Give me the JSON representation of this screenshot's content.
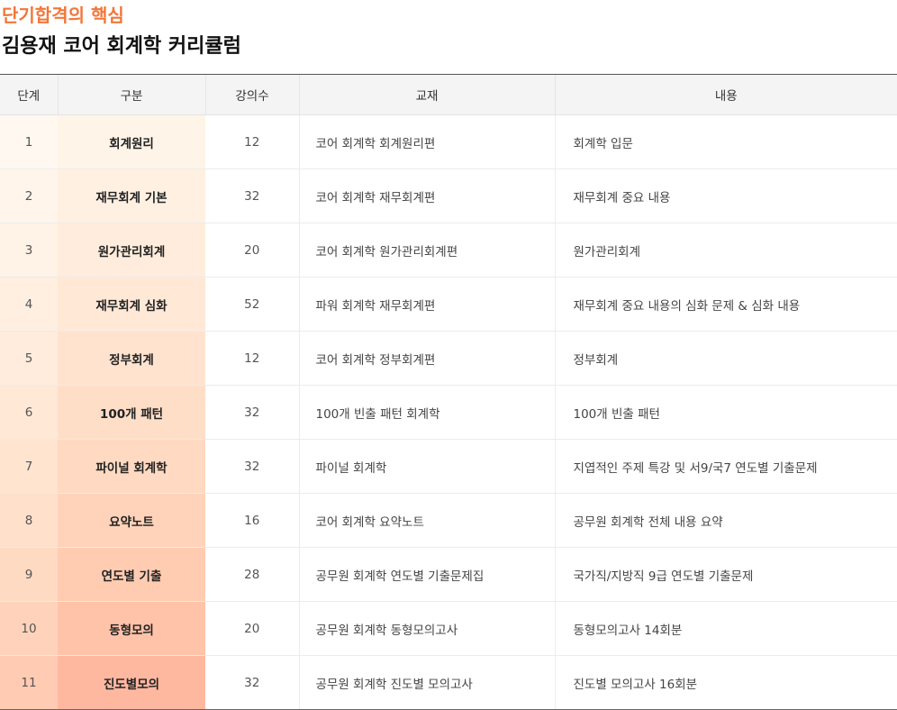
{
  "header": {
    "subtitle": "단기합격의 핵심",
    "title": "김용재 코어 회계학 커리큘럼"
  },
  "table": {
    "columns": [
      "단계",
      "구분",
      "강의수",
      "교재",
      "내용"
    ],
    "rows": [
      {
        "step": "1",
        "name": "회계원리",
        "count": "12",
        "book": "코어 회계학 회계원리편",
        "desc": "회계학 입문",
        "shade_step": "#fff8f0",
        "shade_name": "#fff4e8"
      },
      {
        "step": "2",
        "name": "재무회계 기본",
        "count": "32",
        "book": "코어 회계학 재무회계편",
        "desc": "재무회계 중요 내용",
        "shade_step": "#fff5eb",
        "shade_name": "#fff0e2"
      },
      {
        "step": "3",
        "name": "원가관리회계",
        "count": "20",
        "book": "코어 회계학 원가관리회계편",
        "desc": "원가관리회계",
        "shade_step": "#fff2e6",
        "shade_name": "#ffecdc"
      },
      {
        "step": "4",
        "name": "재무회계 심화",
        "count": "52",
        "book": "파워 회계학 재무회계편",
        "desc": "재무회계 중요 내용의 심화 문제 & 심화 내용",
        "shade_step": "#ffefe1",
        "shade_name": "#ffe8d6"
      },
      {
        "step": "5",
        "name": "정부회계",
        "count": "12",
        "book": "코어 회계학 정부회계편",
        "desc": "정부회계",
        "shade_step": "#ffecdc",
        "shade_name": "#ffe3cf"
      },
      {
        "step": "6",
        "name": "100개 패턴",
        "count": "32",
        "book": "100개 빈출 패턴 회계학",
        "desc": "100개 빈출 패턴",
        "shade_step": "#ffe8d6",
        "shade_name": "#ffdec8"
      },
      {
        "step": "7",
        "name": "파이널 회계학",
        "count": "32",
        "book": "파이널 회계학",
        "desc": "지엽적인 주제 특강 및 서9/국7 연도별 기출문제",
        "shade_step": "#ffe4d0",
        "shade_name": "#ffd9c1"
      },
      {
        "step": "8",
        "name": "요약노트",
        "count": "16",
        "book": "코어 회계학 요약노트",
        "desc": "공무원 회계학 전체 내용 요약",
        "shade_step": "#ffe0ca",
        "shade_name": "#ffd3ba"
      },
      {
        "step": "9",
        "name": "연도별 기출",
        "count": "28",
        "book": "공무원 회계학 연도별 기출문제집",
        "desc": "국가직/지방직 9급 연도별 기출문제",
        "shade_step": "#ffdac3",
        "shade_name": "#ffccb2"
      },
      {
        "step": "10",
        "name": "동형모의",
        "count": "20",
        "book": "공무원 회계학 동형모의고사",
        "desc": "동형모의고사 14회분",
        "shade_step": "#ffd3bb",
        "shade_name": "#ffc3a9"
      },
      {
        "step": "11",
        "name": "진도별모의",
        "count": "32",
        "book": "공무원 회계학 진도별 모의고사",
        "desc": "진도별 모의고사 16회분",
        "shade_step": "#ffcbb2",
        "shade_name": "#ffb8a0"
      }
    ]
  }
}
